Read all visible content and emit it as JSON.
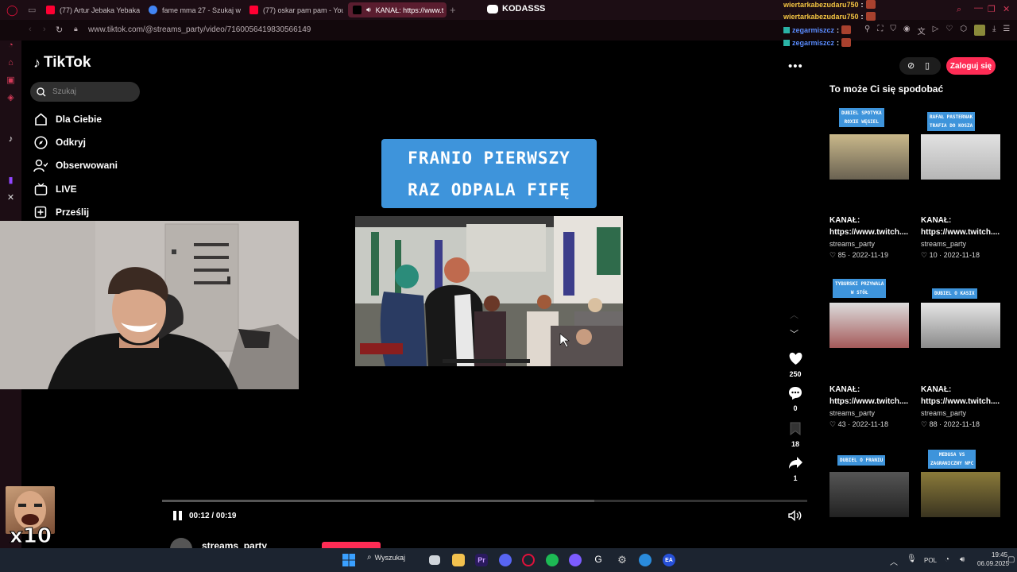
{
  "browser": {
    "tabs": [
      {
        "label": "(77) Artur Jebaka Yebaka",
        "color": "#ff0033"
      },
      {
        "label": "fame mma 27 - Szukaj w",
        "color": "#4285f4"
      },
      {
        "label": "(77) oskar pam pam - You",
        "color": "#ff0033"
      },
      {
        "label": "KANAŁ: https://www.t",
        "color": "#000000",
        "active": true
      }
    ],
    "discord_label": "KODASSS",
    "url": "www.tiktok.com/@streams_party/video/7160056419830566149"
  },
  "tiktok": {
    "logo": "TikTok",
    "search_placeholder": "Szukaj",
    "nav": [
      {
        "label": "Dla Ciebie",
        "icon": "home-icon"
      },
      {
        "label": "Odkryj",
        "icon": "compass-icon"
      },
      {
        "label": "Obserwowani",
        "icon": "following-icon"
      },
      {
        "label": "LIVE",
        "icon": "live-icon"
      },
      {
        "label": "Prześlij",
        "icon": "upload-icon"
      }
    ],
    "login_label": "Zaloguj się",
    "recommend_title": "To może Ci się spodobać"
  },
  "video": {
    "caption_line1": "FRANIO PIERWSZY",
    "caption_line2": "RAZ ODPALA FIFĘ",
    "current_time": "00:12 / 00:19",
    "progress": 0.67,
    "author": "streams_party"
  },
  "actions": {
    "likes": "250",
    "comments": "0",
    "saves": "18",
    "shares": "1"
  },
  "recommendations": [
    {
      "tag": "DUBIEL SPOTYKA\nROXIE WĘGIEL",
      "title_line1": "KANAŁ:",
      "title_line2": "https://www.twitch....",
      "author": "streams_party",
      "meta": "♡ 85 · 2022-11-19"
    },
    {
      "tag": "RAFAŁ PASTERNAK\nTRAFIA DO KOSZA",
      "title_line1": "KANAŁ:",
      "title_line2": "https://www.twitch....",
      "author": "streams_party",
      "meta": "♡ 10 · 2022-11-18"
    },
    {
      "tag": "TYBURSKI PRZYWALA\nW STÓŁ",
      "title_line1": "KANAŁ:",
      "title_line2": "https://www.twitch....",
      "author": "streams_party",
      "meta": "♡ 43 · 2022-11-18"
    },
    {
      "tag": "DUBIEL O KASIX",
      "title_line1": "KANAŁ:",
      "title_line2": "https://www.twitch....",
      "author": "streams_party",
      "meta": "♡ 88 · 2022-11-18"
    },
    {
      "tag": "DUBIEL O FRANIU",
      "title_line1": "",
      "title_line2": "",
      "author": "",
      "meta": ""
    },
    {
      "tag": "MEDUSA VS\nZAGRANICZNY NPC",
      "title_line1": "",
      "title_line2": "",
      "author": "",
      "meta": ""
    }
  ],
  "chat": [
    {
      "user": "wiertarkabezudaru750",
      "color": "#f5c542"
    },
    {
      "user": "wiertarkabezudaru750",
      "color": "#f5c542"
    },
    {
      "user": "zegarmiszcz",
      "color": "#5b8cff"
    },
    {
      "user": "zegarmiszcz",
      "color": "#5b8cff"
    }
  ],
  "overlay": {
    "multiplier": "x10"
  },
  "taskbar": {
    "search_label": "Wyszukaj",
    "lang": "POL",
    "time": "19:45",
    "date": "06.09.2025"
  }
}
